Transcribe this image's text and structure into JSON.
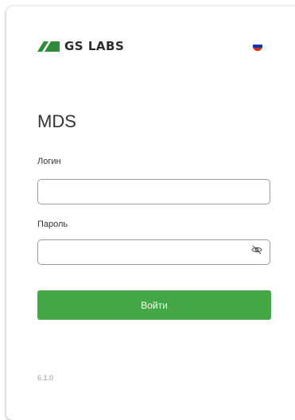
{
  "brand": {
    "name": "GS LABS",
    "color": "#2f8a3a"
  },
  "language": {
    "flag": "russia-flag-icon"
  },
  "app": {
    "title": "MDS"
  },
  "form": {
    "login_label": "Логин",
    "login_value": "",
    "password_label": "Пароль",
    "password_value": "",
    "password_toggle_icon": "eye-off-icon",
    "submit_label": "Войти",
    "submit_color": "#45a846"
  },
  "footer": {
    "version": "6.1.0"
  }
}
